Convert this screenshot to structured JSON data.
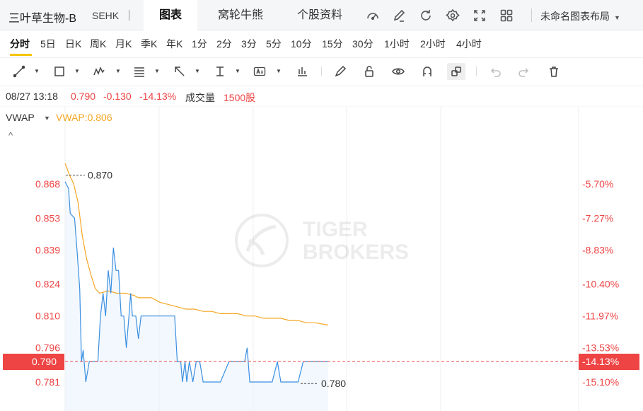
{
  "header": {
    "stock_name": "三叶草生物-B",
    "exchange": "SEHK",
    "separator": "|",
    "tabs": [
      {
        "label": "图表",
        "active": true
      },
      {
        "label": "窝轮牛熊",
        "active": false
      },
      {
        "label": "个股资料",
        "active": false
      }
    ],
    "icons": [
      "gauge-icon",
      "edit-icon",
      "refresh-icon",
      "settings-icon",
      "fullscreen-icon",
      "grid-layout-icon"
    ],
    "layout_select": "未命名图表布局"
  },
  "periods": [
    "分时",
    "5日",
    "日K",
    "周K",
    "月K",
    "季K",
    "年K",
    "1分",
    "2分",
    "3分",
    "5分",
    "10分",
    "15分",
    "30分",
    "1小时",
    "2小时",
    "4小时"
  ],
  "active_period": "分时",
  "toolbar": [
    "line-tool-icon",
    "rectangle-tool-icon",
    "wave-pattern-tool-icon",
    "fibonacci-tool-icon",
    "arrow-tool-icon",
    "measure-tool-icon",
    "text-annotation-tool-icon",
    "bar-indicator-icon",
    "brush-icon",
    "lock-icon",
    "eye-icon",
    "magnet-icon",
    "link-icon",
    "undo-icon",
    "redo-icon",
    "trash-icon"
  ],
  "info": {
    "date_time": "08/27 13:18",
    "price": "0.790",
    "change": "-0.130",
    "change_pct": "-14.13%",
    "volume_label": "成交量",
    "volume": "1500股"
  },
  "indicator": {
    "name": "VWAP",
    "value_text": "VWAP:0.806",
    "collapse_symbol": "^"
  },
  "colors": {
    "up_red": "#ee4444",
    "price_line": "#3b8fe0",
    "vwap_line": "#f5a623",
    "accent_yellow": "#f5c400"
  },
  "chart_data": {
    "type": "line",
    "title": "",
    "price_ticks": [
      "0.868",
      "0.853",
      "0.839",
      "0.824",
      "0.810",
      "0.796",
      "0.781"
    ],
    "pct_ticks": [
      "-5.70%",
      "-7.27%",
      "-8.83%",
      "-10.40%",
      "-11.97%",
      "-13.53%",
      "-15.10%"
    ],
    "ylim": [
      0.776,
      0.877
    ],
    "current_price": {
      "label": "0.790",
      "pct": "-14.13%",
      "value": 0.79
    },
    "high": {
      "label": "0.870",
      "value": 0.87
    },
    "low": {
      "label": "0.780",
      "value": 0.78
    },
    "watermark": [
      "TIGER",
      "BROKERS"
    ],
    "series": [
      {
        "name": "price",
        "points": [
          [
            0,
            0.869
          ],
          [
            0.4,
            0.866
          ],
          [
            0.6,
            0.855
          ],
          [
            1.1,
            0.853
          ],
          [
            1.4,
            0.838
          ],
          [
            1.7,
            0.822
          ],
          [
            1.9,
            0.79
          ],
          [
            2.1,
            0.795
          ],
          [
            2.4,
            0.781
          ],
          [
            2.8,
            0.79
          ],
          [
            3.3,
            0.79
          ],
          [
            3.8,
            0.79
          ],
          [
            4.1,
            0.81
          ],
          [
            4.4,
            0.82
          ],
          [
            4.7,
            0.81
          ],
          [
            5.0,
            0.83
          ],
          [
            5.3,
            0.82
          ],
          [
            5.6,
            0.84
          ],
          [
            5.9,
            0.83
          ],
          [
            6.2,
            0.83
          ],
          [
            6.5,
            0.81
          ],
          [
            6.8,
            0.81
          ],
          [
            7.1,
            0.796
          ],
          [
            7.4,
            0.81
          ],
          [
            7.6,
            0.82
          ],
          [
            7.8,
            0.81
          ],
          [
            8.2,
            0.81
          ],
          [
            8.5,
            0.8
          ],
          [
            8.8,
            0.81
          ],
          [
            9.2,
            0.81
          ],
          [
            10.0,
            0.81
          ],
          [
            11.0,
            0.81
          ],
          [
            12.0,
            0.81
          ],
          [
            12.7,
            0.81
          ],
          [
            13.0,
            0.79
          ],
          [
            13.4,
            0.79
          ],
          [
            13.6,
            0.781
          ],
          [
            13.9,
            0.79
          ],
          [
            14.1,
            0.781
          ],
          [
            14.4,
            0.79
          ],
          [
            14.8,
            0.781
          ],
          [
            15.2,
            0.79
          ],
          [
            15.6,
            0.79
          ],
          [
            16.0,
            0.781
          ],
          [
            17.0,
            0.781
          ],
          [
            18.0,
            0.781
          ],
          [
            19.0,
            0.79
          ],
          [
            20.0,
            0.79
          ],
          [
            20.8,
            0.79
          ],
          [
            21.1,
            0.796
          ],
          [
            21.4,
            0.781
          ],
          [
            22.0,
            0.781
          ],
          [
            23.0,
            0.781
          ],
          [
            24.0,
            0.781
          ],
          [
            24.6,
            0.79
          ],
          [
            25.0,
            0.781
          ],
          [
            26.0,
            0.781
          ],
          [
            27.0,
            0.781
          ],
          [
            27.6,
            0.79
          ],
          [
            28.5,
            0.79
          ],
          [
            30.5,
            0.79
          ]
        ]
      },
      {
        "name": "vwap",
        "points": [
          [
            0,
            0.877
          ],
          [
            0.5,
            0.872
          ],
          [
            1.0,
            0.868
          ],
          [
            1.5,
            0.86
          ],
          [
            2.0,
            0.845
          ],
          [
            2.5,
            0.835
          ],
          [
            3.0,
            0.828
          ],
          [
            3.5,
            0.822
          ],
          [
            4.0,
            0.82
          ],
          [
            5.0,
            0.821
          ],
          [
            6.0,
            0.82
          ],
          [
            7.0,
            0.82
          ],
          [
            8.0,
            0.819
          ],
          [
            8.5,
            0.818
          ],
          [
            9.0,
            0.818
          ],
          [
            10.0,
            0.818
          ],
          [
            11.0,
            0.816
          ],
          [
            12.0,
            0.815
          ],
          [
            13.0,
            0.814
          ],
          [
            14.0,
            0.813
          ],
          [
            15.0,
            0.813
          ],
          [
            16.0,
            0.812
          ],
          [
            17.0,
            0.812
          ],
          [
            18.0,
            0.811
          ],
          [
            19.0,
            0.811
          ],
          [
            20.0,
            0.811
          ],
          [
            21.0,
            0.81
          ],
          [
            22.0,
            0.81
          ],
          [
            23.0,
            0.809
          ],
          [
            24.0,
            0.809
          ],
          [
            25.0,
            0.809
          ],
          [
            26.0,
            0.808
          ],
          [
            27.0,
            0.808
          ],
          [
            28.0,
            0.807
          ],
          [
            29.0,
            0.807
          ],
          [
            30.5,
            0.806
          ]
        ]
      }
    ]
  }
}
